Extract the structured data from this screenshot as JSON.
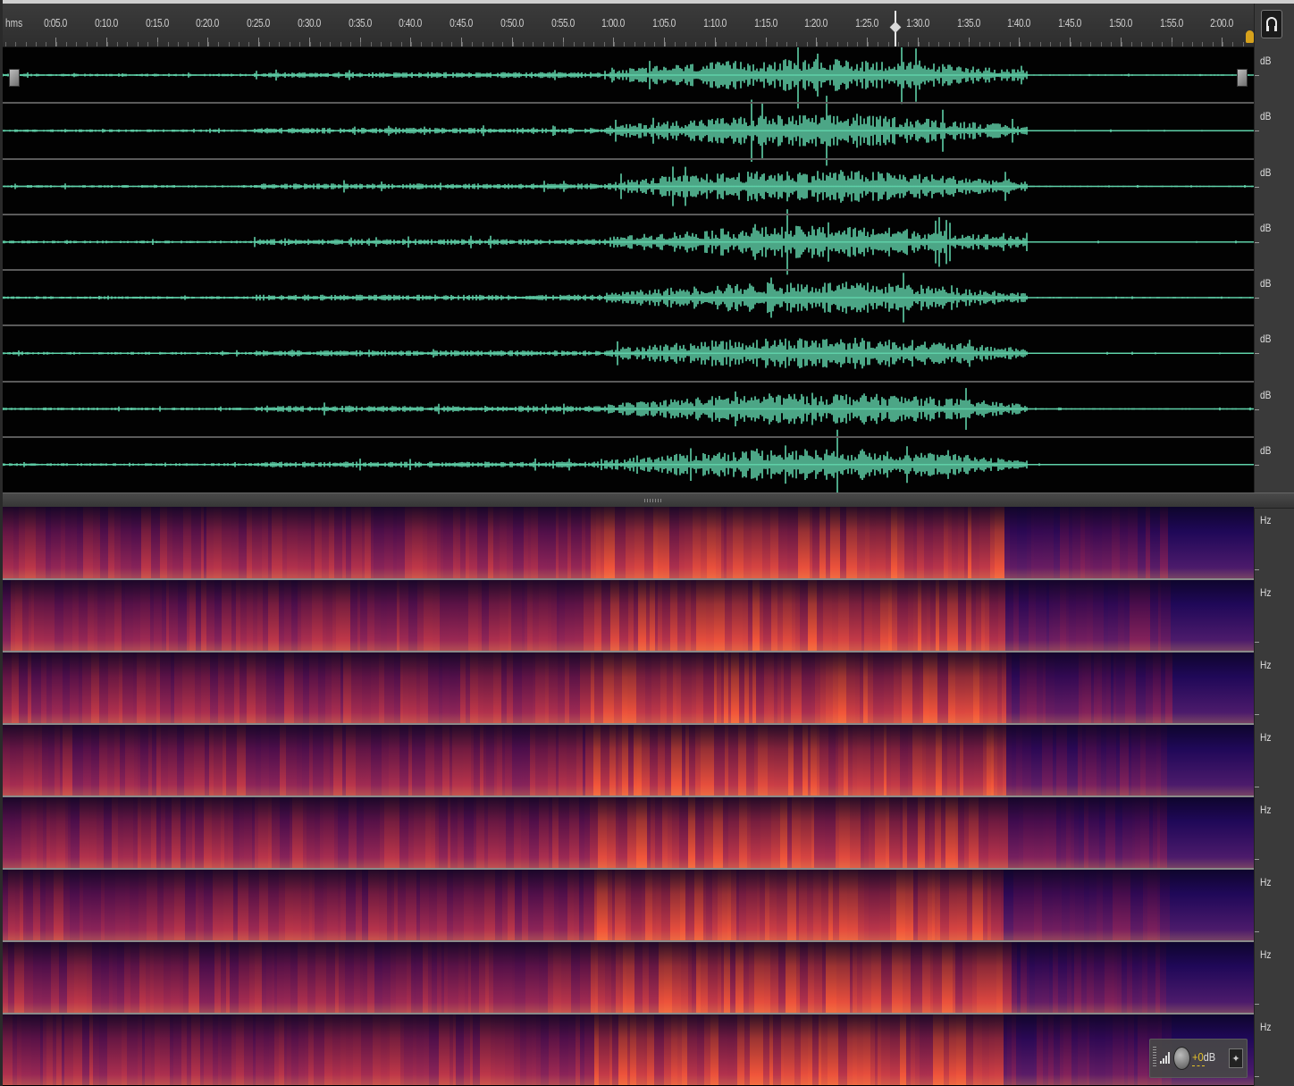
{
  "timeline": {
    "unit_label": "hms",
    "tick_labels": [
      "0:05.0",
      "0:10.0",
      "0:15.0",
      "0:20.0",
      "0:25.0",
      "0:30.0",
      "0:35.0",
      "0:40.0",
      "0:45.0",
      "0:50.0",
      "0:55.0",
      "1:00.0",
      "1:05.0",
      "1:10.0",
      "1:15.0",
      "1:20.0",
      "1:25.0",
      "1:30.0",
      "1:35.0",
      "1:40.0",
      "1:45.0",
      "1:50.0",
      "1:55.0",
      "2:00.0"
    ]
  },
  "waveform": {
    "channel_count": 8,
    "unit_label": "dB",
    "color": "#5fd0a8"
  },
  "spectral": {
    "channel_count": 8,
    "unit_label": "Hz"
  },
  "volume_hud": {
    "value": "+0",
    "unit": "dB",
    "accent": "#e6c229"
  },
  "icons": {
    "headphone": "headphone-icon",
    "level": "level-meter-icon",
    "knob": "volume-knob",
    "pin": "pin-icon"
  }
}
